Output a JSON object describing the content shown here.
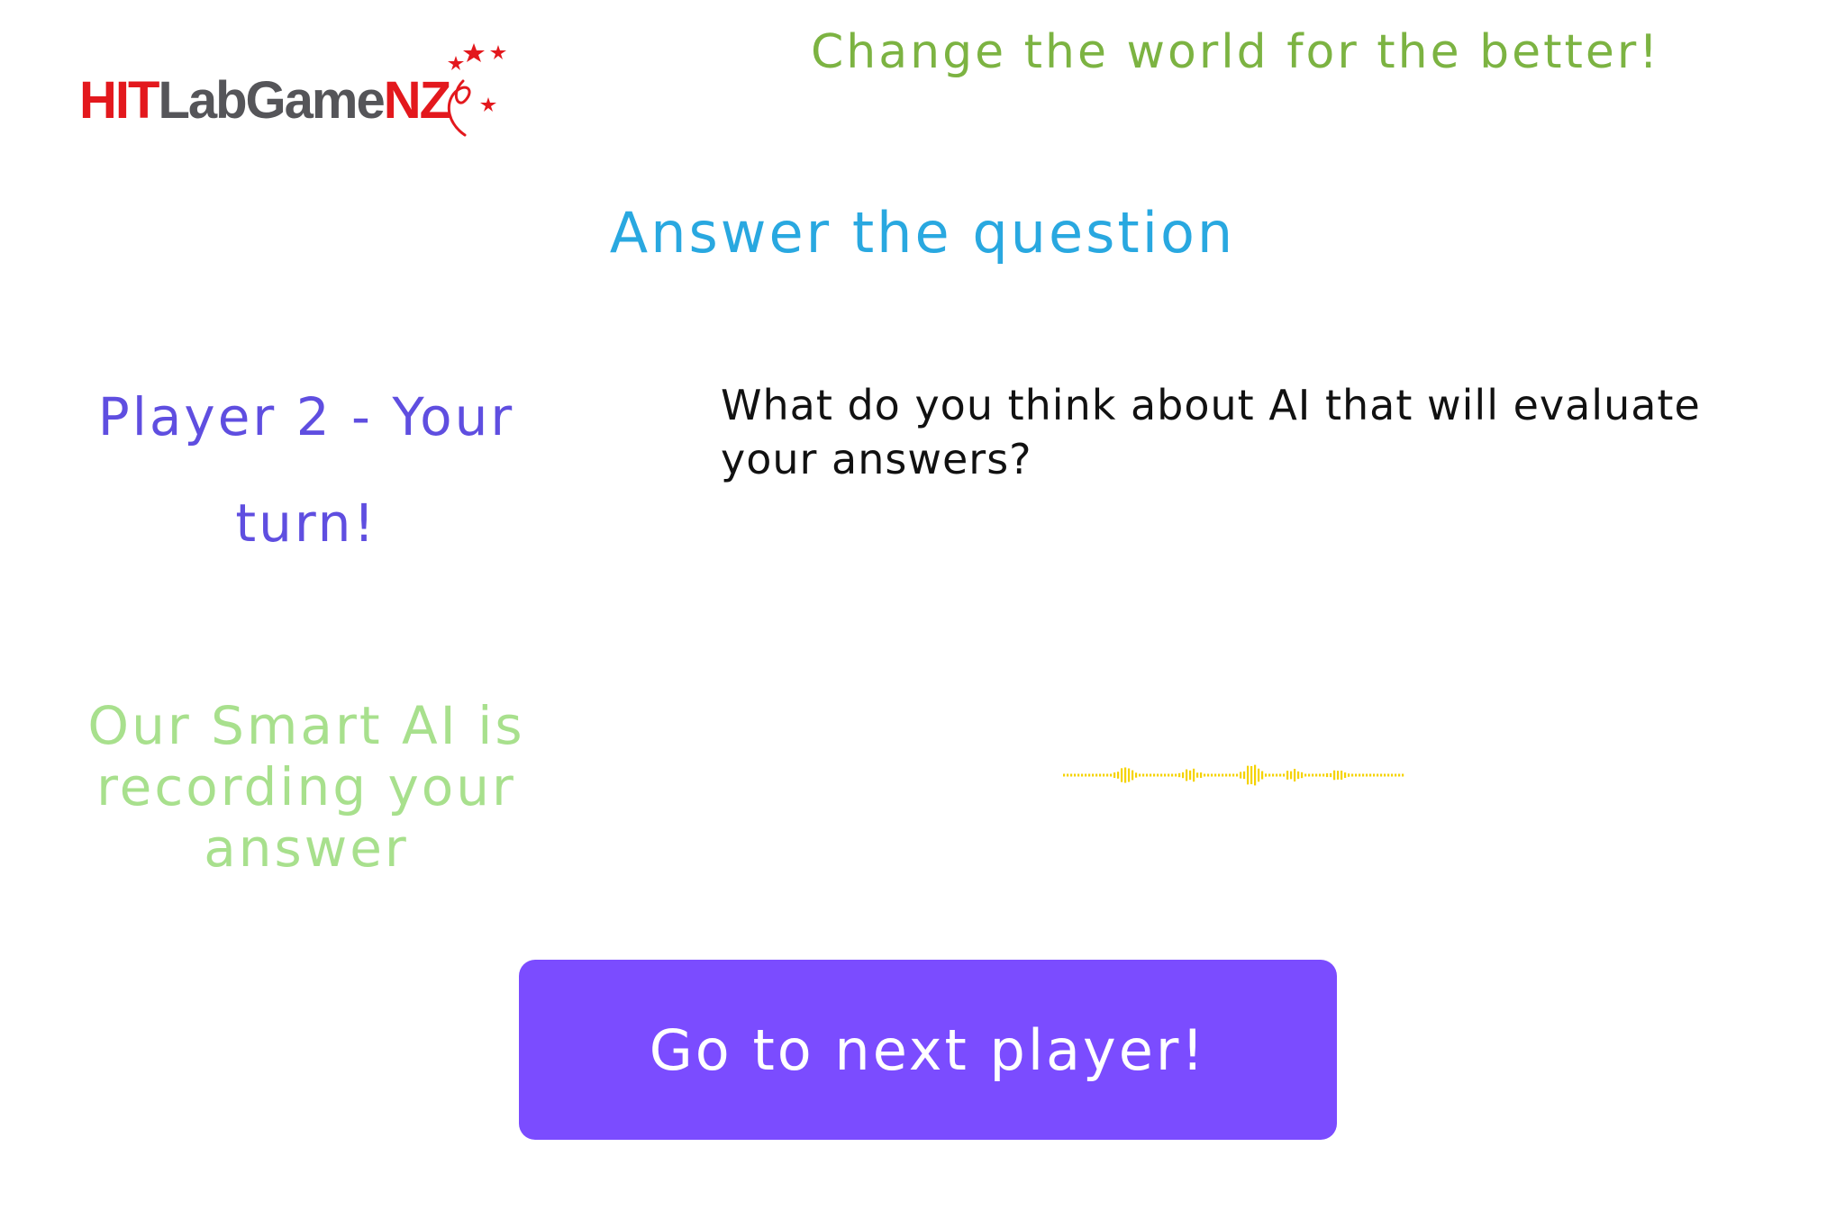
{
  "header": {
    "logo": {
      "part1": "HIT",
      "part2": "LabGame",
      "part3": "NZ"
    },
    "tagline": "Change the world for the better!"
  },
  "section_title": "Answer the question",
  "player_turn": {
    "line1": "Player 2 - Your",
    "line2": "turn!"
  },
  "question": "What do you think about AI that will evaluate your answers?",
  "recording": {
    "line1": "Our Smart AI is",
    "line2": "recording your",
    "line3": "answer"
  },
  "waveform": {
    "icon": "audio-waveform-icon",
    "color": "#f5d300"
  },
  "next_button": {
    "label": "Go to next player!"
  },
  "colors": {
    "brand_red": "#e3181d",
    "tagline_green": "#7cb342",
    "title_blue": "#29a8e0",
    "player_purple": "#5f4ee0",
    "recording_green": "#a8e08d",
    "button_purple": "#7b4cff"
  }
}
